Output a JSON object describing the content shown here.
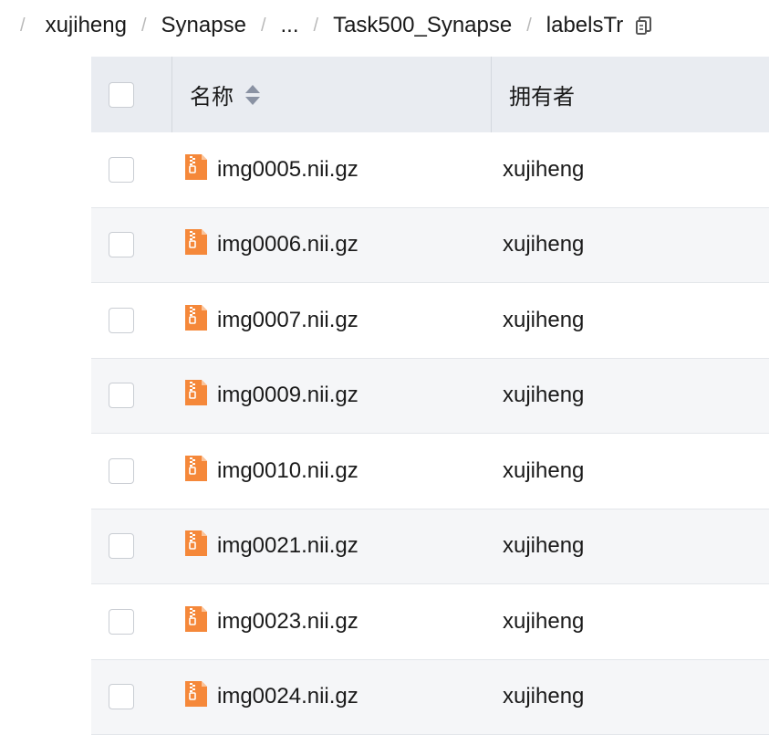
{
  "breadcrumb": {
    "items": [
      "xujiheng",
      "Synapse",
      "...",
      "Task500_Synapse",
      "labelsTr"
    ],
    "separator": "/",
    "copy_icon": "copy-icon"
  },
  "table": {
    "columns": {
      "name": "名称",
      "owner": "拥有者"
    },
    "sort_icon": "sort-icon",
    "file_icon": "zip-file-icon",
    "rows": [
      {
        "name": "img0005.nii.gz",
        "owner": "xujiheng"
      },
      {
        "name": "img0006.nii.gz",
        "owner": "xujiheng"
      },
      {
        "name": "img0007.nii.gz",
        "owner": "xujiheng"
      },
      {
        "name": "img0009.nii.gz",
        "owner": "xujiheng"
      },
      {
        "name": "img0010.nii.gz",
        "owner": "xujiheng"
      },
      {
        "name": "img0021.nii.gz",
        "owner": "xujiheng"
      },
      {
        "name": "img0023.nii.gz",
        "owner": "xujiheng"
      },
      {
        "name": "img0024.nii.gz",
        "owner": "xujiheng"
      }
    ]
  },
  "colors": {
    "header_bg": "#e9ecf1",
    "alt_row_bg": "#f5f6f8",
    "file_icon": "#f5883a"
  }
}
